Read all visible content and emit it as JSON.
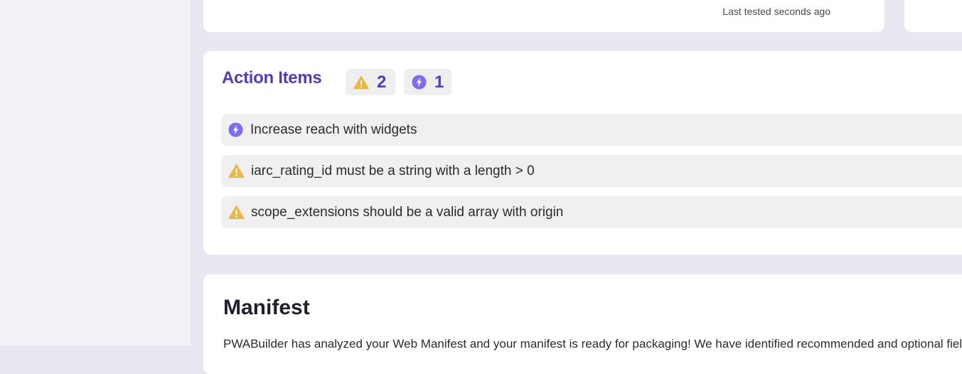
{
  "header_card": {
    "last_tested": "Last tested seconds ago"
  },
  "action_items": {
    "title": "Action Items",
    "warning_count": "2",
    "suggestion_count": "1",
    "items": [
      {
        "icon": "lightning-icon",
        "text": "Increase reach with widgets"
      },
      {
        "icon": "warning-icon",
        "text": "iarc_rating_id must be a string with a length > 0"
      },
      {
        "icon": "warning-icon",
        "text": "scope_extensions should be a valid array with origin"
      }
    ]
  },
  "manifest": {
    "title": "Manifest",
    "description": "PWABuilder has analyzed your Web Manifest and your manifest is ready for packaging! We have identified recommended and optional fields"
  },
  "colors": {
    "accent": "#4f3fb6",
    "warning": "#e8b94a",
    "suggestion": "#7b6cf0",
    "background": "#e8e8f2"
  }
}
